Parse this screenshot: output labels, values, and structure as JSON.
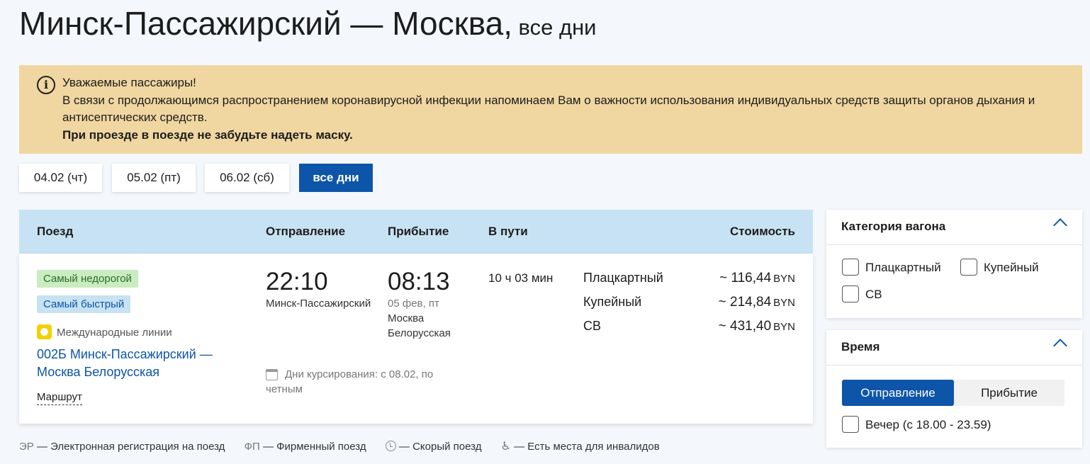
{
  "header": {
    "route_title": "Минск-Пассажирский — Москва,",
    "period": "все дни"
  },
  "notice": {
    "line1": "Уважаемые пассажиры!",
    "line2": "В связи с продолжающимся распространением коронавирусной инфекции напоминаем Вам о важности использования индивидуальных средств защиты органов дыхания и антисептических средств.",
    "line3": "При проезде в поезде не забудьте надеть маску."
  },
  "date_tabs": [
    "04.02 (чт)",
    "05.02 (пт)",
    "06.02 (сб)",
    "все дни"
  ],
  "table_headers": {
    "train": "Поезд",
    "departure": "Отправление",
    "arrival": "Прибытие",
    "duration": "В пути",
    "cost": "Стоимость"
  },
  "train": {
    "badge_cheapest": "Самый недорогой",
    "badge_fastest": "Самый быстрый",
    "international": "Международные линии",
    "name": "002Б Минск-Пассажирский — Москва Белорусская",
    "route_link": "Маршрут",
    "departure_time": "22:10",
    "departure_station": "Минск-Пассажирский",
    "arrival_time": "08:13",
    "arrival_date": "05 фев, пт",
    "arrival_station": "Москва Белорусская",
    "duration": "10 ч 03 мин",
    "schedule": "Дни курсирования: с 08.02, по четным",
    "classes": [
      {
        "name": "Плацкартный",
        "price": "~ 116,44",
        "currency": "BYN"
      },
      {
        "name": "Купейный",
        "price": "~ 214,84",
        "currency": "BYN"
      },
      {
        "name": "СВ",
        "price": "~ 431,40",
        "currency": "BYN"
      }
    ]
  },
  "legend": {
    "er_abbr": "ЭР",
    "er_text": "— Электронная регистрация на поезд",
    "fp_abbr": "ФП",
    "fp_text": "— Фирменный поезд",
    "fast_text": "— Скорый поезд",
    "disabled_text": "— Есть места для инвалидов"
  },
  "filters": {
    "car_category": {
      "title": "Категория вагона",
      "options": [
        "Плацкартный",
        "Купейный",
        "СВ"
      ]
    },
    "time": {
      "title": "Время",
      "segment_active": "Отправление",
      "segment_inactive": "Прибытие",
      "option": "Вечер (с 18.00 - 23.59)"
    }
  },
  "colors": {
    "accent": "#0d55a8",
    "notice_bg": "#f0d6a0",
    "table_header_bg": "#c7e2f3",
    "badge_green_bg": "#c9ecc0",
    "page_bg": "#f4f8fc"
  },
  "icons": [
    "info-icon",
    "international-lines-icon",
    "calendar-icon",
    "clock-icon",
    "wheelchair-icon",
    "chevron-up-icon"
  ]
}
